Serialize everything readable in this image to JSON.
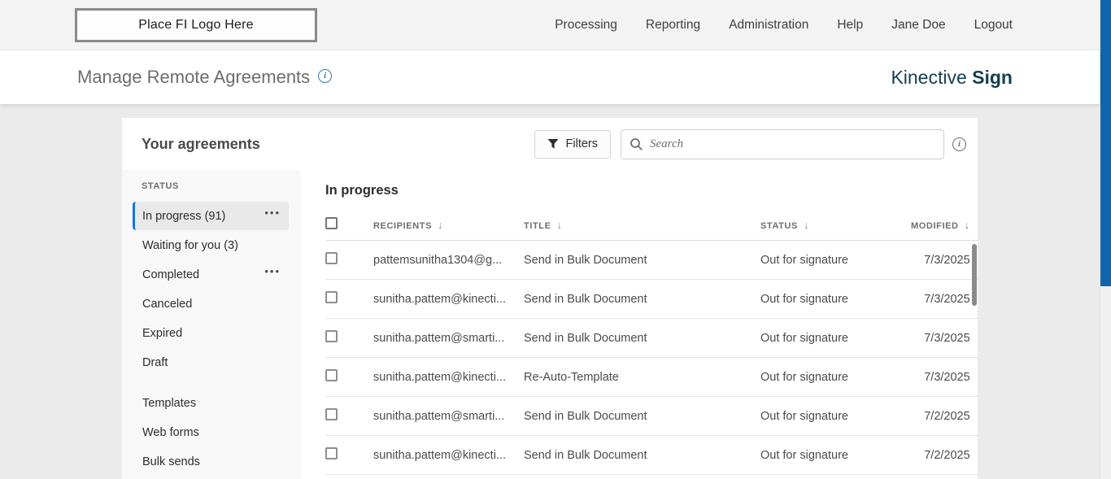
{
  "topbar": {
    "logo_placeholder": "Place FI Logo Here",
    "nav": [
      "Processing",
      "Reporting",
      "Administration",
      "Help",
      "Jane Doe",
      "Logout"
    ]
  },
  "header": {
    "title": "Manage Remote Agreements",
    "brand_name": "Kinective ",
    "brand_product": "Sign"
  },
  "panel": {
    "title": "Your agreements",
    "filters_label": "Filters",
    "search_placeholder": "Search"
  },
  "sidebar": {
    "section_label": "STATUS",
    "status_items": [
      {
        "label": "In progress (91)",
        "selected": true,
        "menu_glyph": "•••"
      },
      {
        "label": "Waiting for you (3)",
        "selected": false,
        "menu_glyph": ""
      },
      {
        "label": "Completed",
        "selected": false,
        "menu_glyph": "•••"
      },
      {
        "label": "Canceled",
        "selected": false,
        "menu_glyph": ""
      },
      {
        "label": "Expired",
        "selected": false,
        "menu_glyph": ""
      },
      {
        "label": "Draft",
        "selected": false,
        "menu_glyph": ""
      }
    ],
    "other_items": [
      {
        "label": "Templates"
      },
      {
        "label": "Web forms"
      },
      {
        "label": "Bulk sends"
      }
    ]
  },
  "table": {
    "section_title": "In progress",
    "sort_arrow": "↓",
    "columns": [
      "RECIPIENTS",
      "TITLE",
      "STATUS",
      "MODIFIED"
    ],
    "rows": [
      {
        "recipient": "pattemsunitha1304@g...",
        "title": "Send in Bulk Document",
        "status": "Out for signature",
        "modified": "7/3/2025"
      },
      {
        "recipient": "sunitha.pattem@kinecti...",
        "title": "Send in Bulk Document",
        "status": "Out for signature",
        "modified": "7/3/2025"
      },
      {
        "recipient": "sunitha.pattem@smarti...",
        "title": "Send in Bulk Document",
        "status": "Out for signature",
        "modified": "7/3/2025"
      },
      {
        "recipient": "sunitha.pattem@kinecti...",
        "title": "Re-Auto-Template",
        "status": "Out for signature",
        "modified": "7/3/2025"
      },
      {
        "recipient": "sunitha.pattem@smarti...",
        "title": "Send in Bulk Document",
        "status": "Out for signature",
        "modified": "7/2/2025"
      },
      {
        "recipient": "sunitha.pattem@kinecti...",
        "title": "Send in Bulk Document",
        "status": "Out for signature",
        "modified": "7/2/2025"
      }
    ]
  },
  "icons": {
    "info": "i",
    "filter": "funnel",
    "search": "magnifier"
  },
  "colors": {
    "accent_blue": "#1473e6",
    "brand_teal": "#14404f",
    "scrollbar_blue": "#1066ad",
    "panel_bg": "#ffffff",
    "page_bg": "#ebebeb",
    "topbar_bg": "#f3f3f3"
  }
}
